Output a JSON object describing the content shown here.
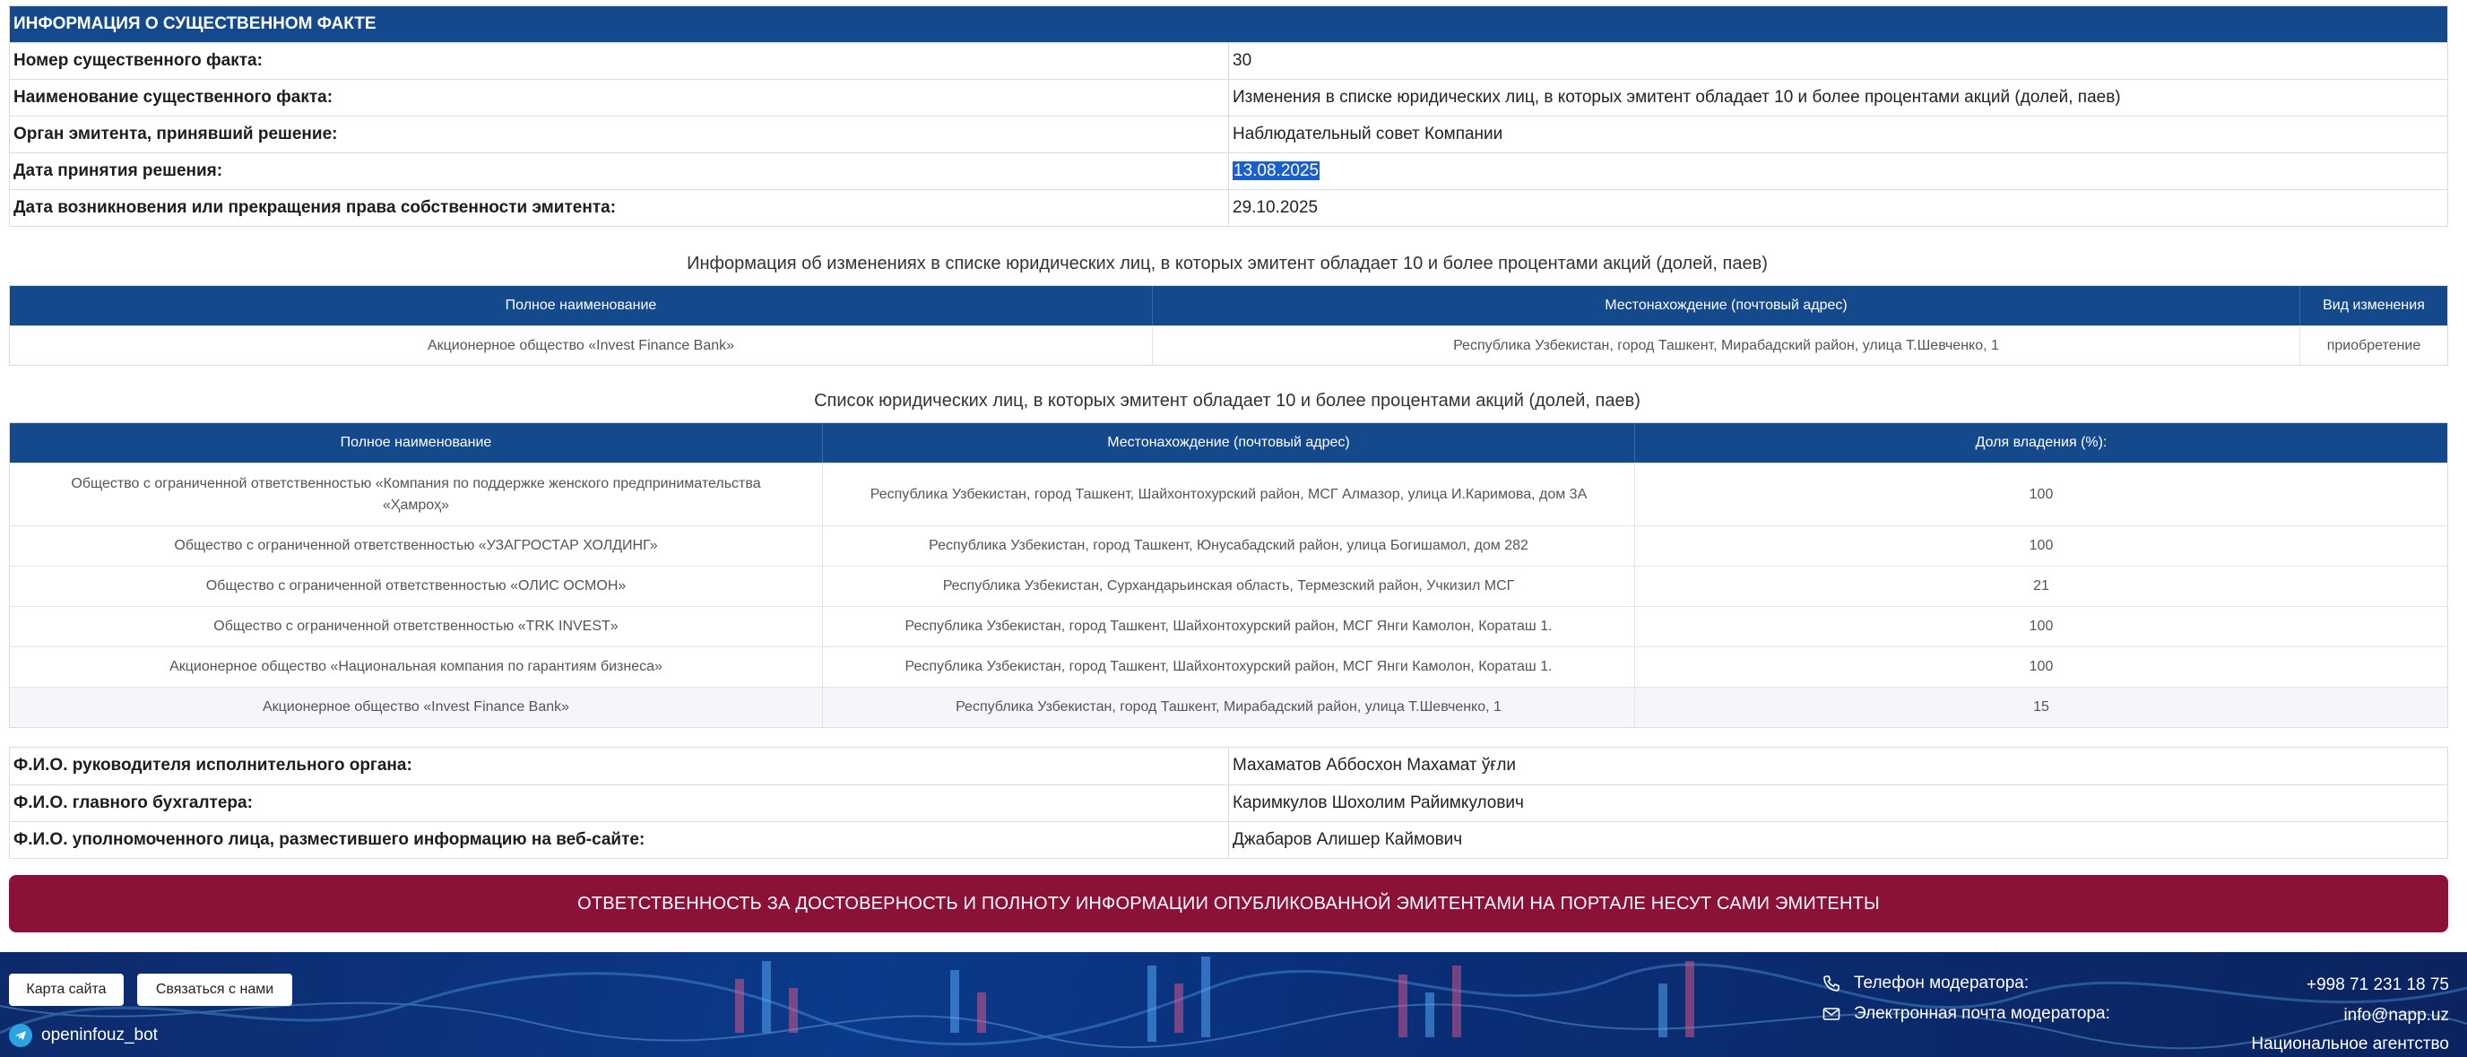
{
  "facts": {
    "header": "ИНФОРМАЦИЯ О СУЩЕСТВЕННОМ ФАКТЕ",
    "rows": [
      {
        "label": "Номер существенного факта:",
        "value": "30"
      },
      {
        "label": "Наименование существенного факта:",
        "value": "Изменения в списке юридических лиц, в которых эмитент обладает 10 и более процентами акций (долей, паев)"
      },
      {
        "label": "Орган эмитента, принявший решение:",
        "value": "Наблюдательный совет Компании"
      },
      {
        "label": "Дата принятия решения:",
        "value": "13.08.2025"
      },
      {
        "label": "Дата возникновения или прекращения права собственности эмитента:",
        "value": "29.10.2025"
      }
    ]
  },
  "changes": {
    "caption": "Информация об изменениях в списке юридических лиц, в которых эмитент обладает 10 и более процентами акций (долей, паев)",
    "headers": [
      "Полное наименование",
      "Местонахождение (почтовый адрес)",
      "Вид изменения"
    ],
    "rows": [
      [
        "Акционерное общество «Invest Finance Bank»",
        "Республика Узбекистан, город Ташкент, Мирабадский район, улица Т.Шевченко, 1",
        "приобретение"
      ]
    ]
  },
  "holdings": {
    "caption": "Список юридических лиц, в которых эмитент обладает 10 и более процентами акций (долей, паев)",
    "headers": [
      "Полное наименование",
      "Местонахождение (почтовый адрес)",
      "Доля владения (%):"
    ],
    "rows": [
      [
        "Общество с ограниченной ответственностью «Компания по поддержке женского предпринимательства «Ҳамроҳ»",
        "Республика Узбекистан, город Ташкент, Шайхонтохурский район, МСГ Алмазор, улица И.Каримова, дом 3А",
        "100"
      ],
      [
        "Общество с ограниченной ответственностью «УЗАГРОСТАР ХОЛДИНГ»",
        "Республика Узбекистан, город Ташкент, Юнусабадский район, улица Богишамол, дом 282",
        "100"
      ],
      [
        "Общество с ограниченной ответственностью «ОЛИС ОСМОН»",
        "Республика Узбекистан, Сурхандарьинская область, Термезский район, Учкизил МСГ",
        "21"
      ],
      [
        "Общество с ограниченной ответственностью «TRK INVEST»",
        "Республика Узбекистан, город Ташкент, Шайхонтохурский район, МСГ Янги Камолон, Кораташ 1.",
        "100"
      ],
      [
        "Акционерное общество «Национальная компания по гарантиям бизнеса»",
        "Республика Узбекистан, город Ташкент, Шайхонтохурский район, МСГ Янги Камолон, Кораташ 1.",
        "100"
      ],
      [
        "Акционерное общество «Invest Finance Bank»",
        "Республика Узбекистан, город Ташкент, Мирабадский район, улица Т.Шевченко, 1",
        "15"
      ]
    ]
  },
  "signatures": [
    {
      "label": "Ф.И.О. руководителя исполнительного органа:",
      "value": "Махаматов Аббосхон Махамат ўғли"
    },
    {
      "label": "Ф.И.О. главного бухгалтера:",
      "value": "Каримкулов Шохолим Райимкулович"
    },
    {
      "label": "Ф.И.О. уполномоченного лица, разместившего информацию на веб-сайте:",
      "value": "Джабаров Алишер Каймович"
    }
  ],
  "banner": "ОТВЕТСТВЕННОСТЬ ЗА ДОСТОВЕРНОСТЬ И ПОЛНОТУ ИНФОРМАЦИИ ОПУБЛИКОВАННОЙ ЭМИТЕНТАМИ НА ПОРТАЛЕ НЕСУТ САМИ ЭМИТЕНТЫ",
  "footer": {
    "sitemap": "Карта сайта",
    "contact_us": "Связаться с нами",
    "bot": "openinfouz_bot",
    "phone_label": "Телефон модератора:",
    "phone_value": "+998 71 231 18 75",
    "email_label": "Электронная почта модератора:",
    "email_value": "info@napp.uz",
    "agency": "Национальное агентство",
    "icons": {
      "phone": "phone-icon",
      "email": "mail-icon",
      "bot": "telegram-icon"
    }
  },
  "colors": {
    "header_blue": "#144a8c",
    "banner": "#8b1136",
    "selection": "#1a5fcf"
  }
}
